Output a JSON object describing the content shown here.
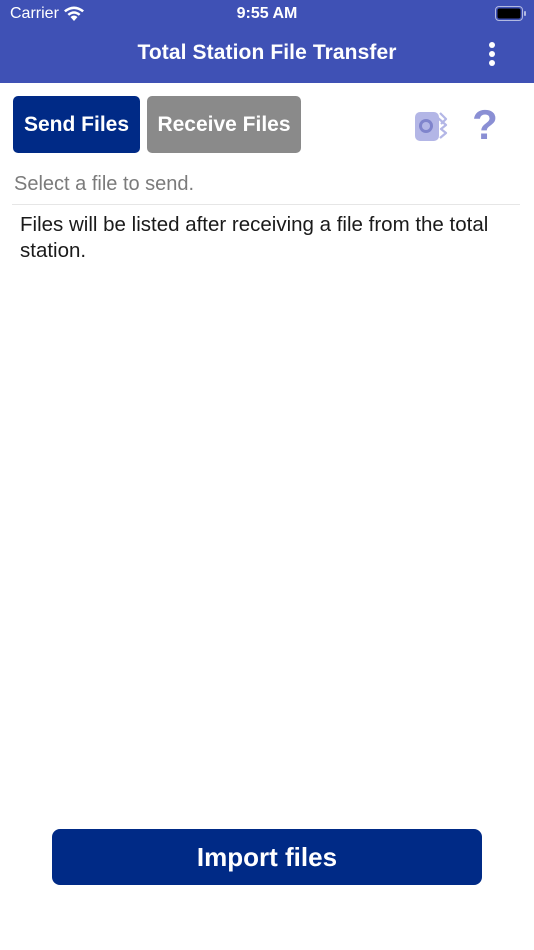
{
  "status_bar": {
    "carrier": "Carrier",
    "time": "9:55 AM"
  },
  "header": {
    "title": "Total Station File Transfer",
    "background_color": "#3f51b5"
  },
  "tabs": {
    "send_label": "Send Files",
    "receive_label": "Receive Files",
    "active": "send"
  },
  "icons": {
    "bluetooth": "bluetooth-device-icon",
    "help": "?"
  },
  "file_list": {
    "prompt": "Select a file to send.",
    "empty_message": "Files will be listed after receiving a file from the total station."
  },
  "footer": {
    "import_label": "Import files",
    "button_color": "#002a86"
  }
}
